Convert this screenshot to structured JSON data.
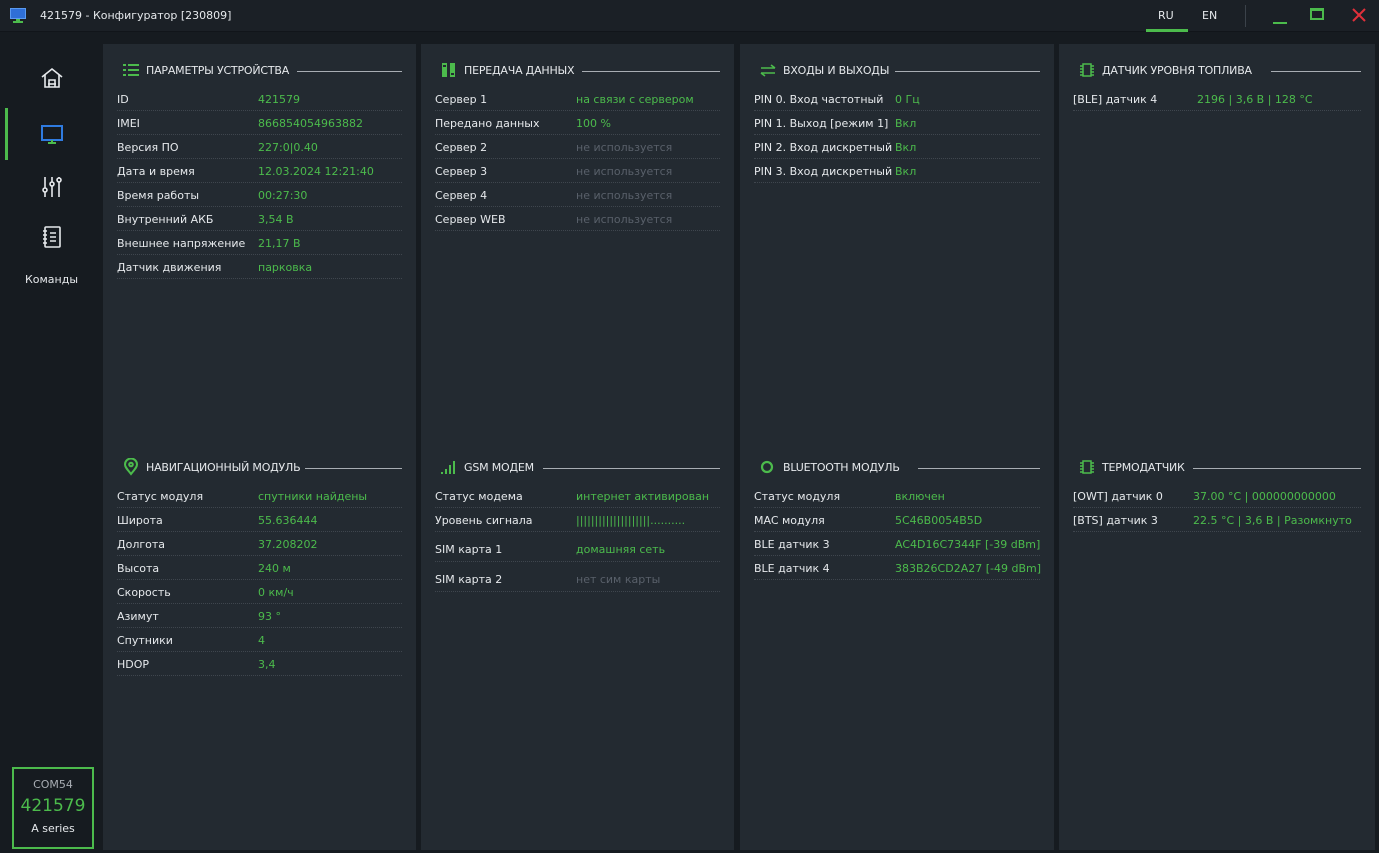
{
  "window": {
    "title": "421579 - Конфигуратор [230809]"
  },
  "lang": {
    "ru": "RU",
    "en": "EN"
  },
  "colors": {
    "accent": "#4cbb4c",
    "muted": "#59606a",
    "close": "#e0303a",
    "panel": "#232a31",
    "bg": "#161b20"
  },
  "sidebar": {
    "items": [
      {
        "name": "home-icon"
      },
      {
        "name": "monitor-icon",
        "active": true
      },
      {
        "name": "sliders-icon"
      },
      {
        "name": "notebook-icon"
      }
    ],
    "commands_label": "Команды",
    "device": {
      "port": "COM54",
      "id": "421579",
      "series": "A series"
    }
  },
  "sections": {
    "device_params": {
      "title": "ПАРАМЕТРЫ УСТРОЙСТВА",
      "icon": "list-icon",
      "rows": [
        {
          "k": "ID",
          "v": "421579"
        },
        {
          "k": "IMEI",
          "v": "866854054963882"
        },
        {
          "k": "Версия ПО",
          "v": "227:0|0.40"
        },
        {
          "k": "Дата и время",
          "v": "12.03.2024 12:21:40"
        },
        {
          "k": "Время работы",
          "v": "00:27:30"
        },
        {
          "k": "Внутренний АКБ",
          "v": "3,54 В"
        },
        {
          "k": "Внешнее напряжение",
          "v": "21,17 В"
        },
        {
          "k": "Датчик движения",
          "v": "парковка"
        }
      ]
    },
    "data_transfer": {
      "title": "ПЕРЕДАЧА ДАННЫХ",
      "icon": "transfer-icon",
      "rows": [
        {
          "k": "Сервер 1",
          "v": "на связи с сервером"
        },
        {
          "k": "Передано данных",
          "v": "100 %"
        },
        {
          "k": "Сервер 2",
          "v": "не используется",
          "muted": true
        },
        {
          "k": "Сервер 3",
          "v": "не используется",
          "muted": true
        },
        {
          "k": "Сервер 4",
          "v": "не используется",
          "muted": true
        },
        {
          "k": "Сервер WEB",
          "v": "не используется",
          "muted": true
        }
      ]
    },
    "io": {
      "title": "ВХОДЫ и ВЫХОДЫ",
      "icon": "arrows-exchange-icon",
      "rows": [
        {
          "k": "PIN 0. Вход частотный",
          "v": "0 Гц"
        },
        {
          "k": "PIN 1. Выход [режим 1]",
          "v": "Вкл"
        },
        {
          "k": "PIN 2. Вход дискретный",
          "v": "Вкл"
        },
        {
          "k": "PIN 3. Вход дискретный",
          "v": "Вкл"
        }
      ]
    },
    "fuel": {
      "title": "ДАТЧИК УРОВНЯ ТОПЛИВА",
      "icon": "chip-icon",
      "rows": [
        {
          "k": "[BLE] датчик 4",
          "v": "2196 | 3,6 В | 128 °C"
        }
      ]
    },
    "nav": {
      "title": "НАВИГАЦИОННЫЙ МОДУЛЬ",
      "icon": "location-pin-icon",
      "rows": [
        {
          "k": "Статус модуля",
          "v": "спутники найдены"
        },
        {
          "k": "Широта",
          "v": "55.636444"
        },
        {
          "k": "Долгота",
          "v": "37.208202"
        },
        {
          "k": "Высота",
          "v": "240 м"
        },
        {
          "k": "Скорость",
          "v": "0 км/ч"
        },
        {
          "k": "Азимут",
          "v": "93 °"
        },
        {
          "k": "Спутники",
          "v": "4"
        },
        {
          "k": "HDOP",
          "v": "3,4"
        }
      ]
    },
    "gsm": {
      "title": "GSM МОДЕМ",
      "icon": "signal-bars-icon",
      "rows": [
        {
          "k": "Статус модема",
          "v": "интернет активирован"
        },
        {
          "k": "Уровень сигнала",
          "v": "||||||||||||||||||||.........."
        },
        {
          "k": "SIM карта 1",
          "v": "домашняя сеть",
          "tall": true
        },
        {
          "k": "SIM карта 2",
          "v": "нет сим карты",
          "muted": true,
          "tall": true
        }
      ]
    },
    "bt": {
      "title": "BLUETOOTH МОДУЛЬ",
      "icon": "bluetooth-ring-icon",
      "rows": [
        {
          "k": "Статус модуля",
          "v": "включен"
        },
        {
          "k": "MAC модуля",
          "v": "5C46B0054B5D"
        },
        {
          "k": "BLE датчик 3",
          "v": "AC4D16C7344F [-39 dBm]"
        },
        {
          "k": "BLE датчик 4",
          "v": "383B26CD2A27 [-49 dBm]"
        }
      ]
    },
    "thermo": {
      "title": "ТЕРМОДАТЧИК",
      "icon": "chip-icon",
      "rows": [
        {
          "k": "[OWT] датчик 0",
          "v": "37.00 °C | 000000000000"
        },
        {
          "k": "[BTS] датчик 3",
          "v": "22.5 °C | 3,6 В | Разомкнуто"
        }
      ]
    }
  }
}
